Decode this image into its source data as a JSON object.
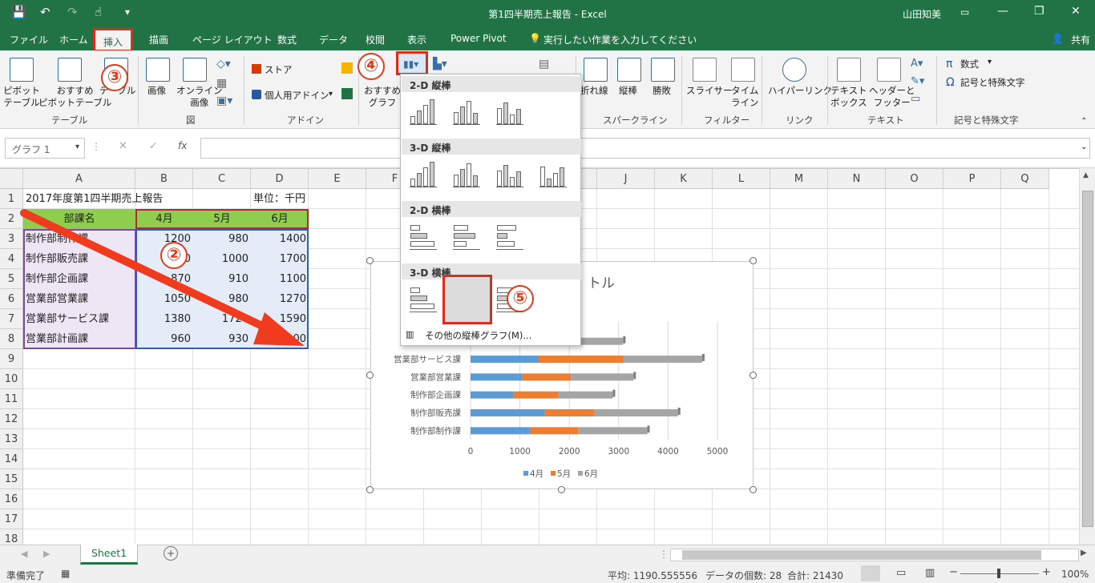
{
  "window": {
    "title": "第1四半期売上報告 - Excel",
    "user": "山田知美",
    "minimize": "—",
    "restore": "❐",
    "close": "✕"
  },
  "qat": {
    "save": "💾",
    "undo": "↶",
    "redo": "↷",
    "touch": "☝",
    "customize": "▾"
  },
  "tabs": [
    "ファイル",
    "ホーム",
    "挿入",
    "描画",
    "ページ レイアウト",
    "数式",
    "データ",
    "校閲",
    "表示",
    "Power Pivot"
  ],
  "tellme": "実行したい作業を入力してください",
  "share": "共有",
  "ribbon": {
    "pivot": "ピボット\nテーブル",
    "rec_pivot": "おすすめ\nピボットテーブル",
    "table": "テーブル",
    "group_table": "テーブル",
    "picture": "画像",
    "online_picture": "オンライン\n画像",
    "group_illust": "図",
    "store": "ストア",
    "my_addins": "個人用アドイン",
    "group_addins": "アドイン",
    "rec_chart": "おすすめ\nグラフ",
    "sparkline_line": "折れ線",
    "sparkline_col": "縦棒",
    "sparkline_wl": "勝敗",
    "group_sparkline": "スパークライン",
    "slicer": "スライサー",
    "timeline": "タイム\nライン",
    "group_filter": "フィルター",
    "hyperlink": "ハイパーリンク",
    "group_link": "リンク",
    "textbox": "テキスト\nボックス",
    "headerfooter": "ヘッダーと\nフッター",
    "group_text": "テキスト",
    "equation": "数式",
    "symbol": "記号と特殊文字",
    "group_symbol": "記号と特殊文字"
  },
  "namebox": "グラフ 1",
  "fx": "fx",
  "columns": [
    "A",
    "B",
    "C",
    "D",
    "E",
    "F",
    "G",
    "H",
    "I",
    "J",
    "K",
    "L",
    "M",
    "N",
    "O",
    "P",
    "Q"
  ],
  "rows": [
    "1",
    "2",
    "3",
    "4",
    "5",
    "6",
    "7",
    "8",
    "9",
    "10",
    "11",
    "12",
    "13",
    "14",
    "15",
    "16",
    "17",
    "18"
  ],
  "sheet": {
    "a1": "2017年度第1四半期売上報告",
    "d1": "単位：千円",
    "header": [
      "部課名",
      "4月",
      "5月",
      "6月"
    ],
    "data": [
      [
        "制作部制作課",
        "1200",
        "980",
        "1400"
      ],
      [
        "制作部販売課",
        "1500",
        "1000",
        "1700"
      ],
      [
        "制作部企画課",
        "870",
        "910",
        "1100"
      ],
      [
        "営業部営業課",
        "1050",
        "980",
        "1270"
      ],
      [
        "営業部サービス課",
        "1380",
        "1720",
        "1590"
      ],
      [
        "営業部計画課",
        "960",
        "930",
        "1200"
      ]
    ]
  },
  "dropdown": {
    "sec1": "2-D 縦棒",
    "sec2": "3-D 縦棒",
    "sec3": "2-D 横棒",
    "sec4": "3-D 横棒",
    "more": "その他の縦棒グラフ(M)..."
  },
  "chart_data": {
    "type": "bar",
    "stacked": true,
    "title": "トル",
    "categories": [
      "制作部制作課",
      "制作部販売課",
      "制作部企画課",
      "営業部営業課",
      "営業部サービス課",
      "営業部計画課"
    ],
    "series": [
      {
        "name": "4月",
        "values": [
          1200,
          1500,
          870,
          1050,
          1380,
          960
        ],
        "color": "#5b9bd5"
      },
      {
        "name": "5月",
        "values": [
          980,
          1000,
          910,
          980,
          1720,
          930
        ],
        "color": "#ed7d31"
      },
      {
        "name": "6月",
        "values": [
          1400,
          1700,
          1100,
          1270,
          1590,
          1200
        ],
        "color": "#a5a5a5"
      }
    ],
    "xlim": [
      0,
      5000
    ],
    "xticks": [
      "0",
      "1000",
      "2000",
      "3000",
      "4000",
      "5000"
    ],
    "legend": "bottom"
  },
  "callouts": [
    "②",
    "③",
    "④",
    "⑤"
  ],
  "sheet_tab": "Sheet1",
  "status": {
    "ready": "準備完了",
    "average": "平均: 1190.555556",
    "count": "データの個数: 28",
    "sum": "合計: 21430",
    "zoom": "100%"
  },
  "colors": {
    "excel_green": "#217346",
    "callout_red": "#e33a1c"
  }
}
